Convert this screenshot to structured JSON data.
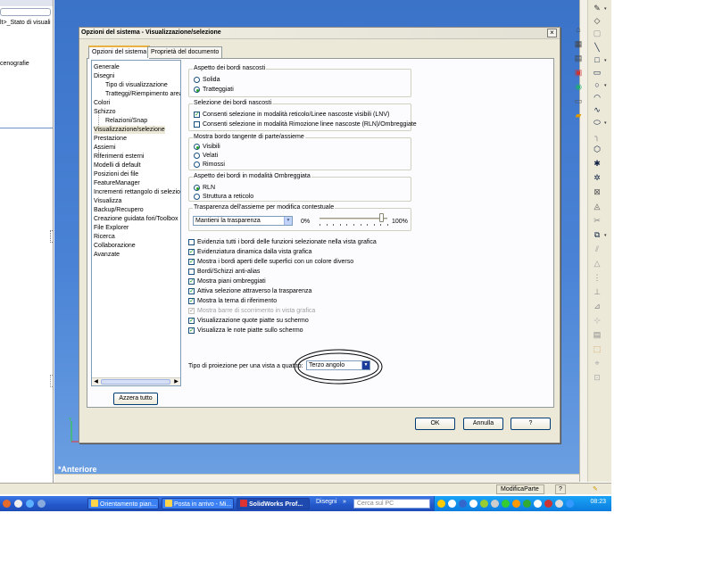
{
  "left_pane": {
    "tree_text_1": "lt>_Stato di visuali",
    "tree_text_2": "cenografie"
  },
  "graphics": {
    "view_label": "*Anteriore"
  },
  "dialog": {
    "title": "Opzioni del sistema - Visualizzazione/selezione",
    "close_glyph": "×",
    "tabs": [
      "Opzioni del sistema",
      "Proprietà del documento"
    ],
    "tree": [
      "Generale",
      "Disegni",
      "Tipo di visualizzazione",
      "Tratteggi/Riempimento area",
      "Colori",
      "Schizzo",
      "Relazioni/Snap",
      "Visualizzazione/selezione",
      "Prestazione",
      "Assiemi",
      "Riferimenti esterni",
      "Modelli di default",
      "Posizioni dei file",
      "FeatureManager",
      "Incrementi rettangolo di selezione",
      "Visualizza",
      "Backup/Recupero",
      "Creazione guidata fori/Toolbox",
      "File Explorer",
      "Ricerca",
      "Collaborazione",
      "Avanzate"
    ],
    "reset_button": "Azzera tutto",
    "hidden_edges": {
      "label": "Aspetto dei bordi nascosti",
      "options": [
        "Solida",
        "Tratteggiati"
      ],
      "selected": 1
    },
    "hidden_selection": {
      "label": "Selezione dei bordi nascosti",
      "options": [
        {
          "label": "Consenti selezione in modalità reticolo/Linee nascoste visibili (LNV)",
          "checked": true
        },
        {
          "label": "Consenti selezione in modalità Rimozione linee nascoste (RLN)/Ombreggiate",
          "checked": false
        }
      ]
    },
    "tangent_edges": {
      "label": "Mostra bordo tangente di parte/assieme",
      "options": [
        "Visibili",
        "Velati",
        "Rimossi"
      ],
      "selected": 0
    },
    "shaded_edges": {
      "label": "Aspetto dei bordi in modalità Ombreggiata",
      "options": [
        "RLN",
        "Struttura a reticolo"
      ],
      "selected": 0
    },
    "transparency": {
      "label": "Trasparenza dell'assieme per modifica contestuale",
      "mode": "Mantieni la trasparenza",
      "min_label": "0%",
      "max_label": "100%",
      "level": 0.92
    },
    "checkboxes": [
      {
        "label": "Evidenzia tutti i bordi delle funzioni selezionate nella vista grafica",
        "checked": false,
        "disabled": false
      },
      {
        "label": "Evidenziatura dinamica dalla vista grafica",
        "checked": true,
        "disabled": false
      },
      {
        "label": "Mostra i bordi aperti delle superfici con un colore diverso",
        "checked": true,
        "disabled": false
      },
      {
        "label": "Bordi/Schizzi anti-alias",
        "checked": false,
        "disabled": false
      },
      {
        "label": "Mostra piani ombreggiati",
        "checked": true,
        "disabled": false
      },
      {
        "label": "Attiva selezione attraverso la trasparenza",
        "checked": true,
        "disabled": false
      },
      {
        "label": "Mostra la terna di riferimento",
        "checked": true,
        "disabled": false
      },
      {
        "label": "Mostra barre di scorrimento in vista grafica",
        "checked": true,
        "disabled": true
      },
      {
        "label": "Visualizzazione quote piatte su schermo",
        "checked": true,
        "disabled": false
      },
      {
        "label": "Visualizza le note piatte sullo schermo",
        "checked": true,
        "disabled": false
      }
    ],
    "projection": {
      "label": "Tipo di proiezione per una vista a quattro:",
      "value": "Terzo angolo"
    },
    "ok": "OK",
    "cancel": "Annulla",
    "help": "?"
  },
  "statusbar": {
    "mode": "ModificaParte",
    "help_glyph": "?"
  },
  "taskbar": {
    "tasks": [
      "Orientamento pian...",
      "Posta in arrivo - Mi...",
      "SolidWorks Prof...",
      "Disegni"
    ],
    "more": "»",
    "search_placeholder": "Cerca sul PC",
    "clock": "08:23"
  },
  "colors": {
    "graphics_top": "#3a73c8",
    "taskbar": "#2357c9",
    "dialog_bg": "#ece9d8",
    "check_green": "#21a121"
  }
}
